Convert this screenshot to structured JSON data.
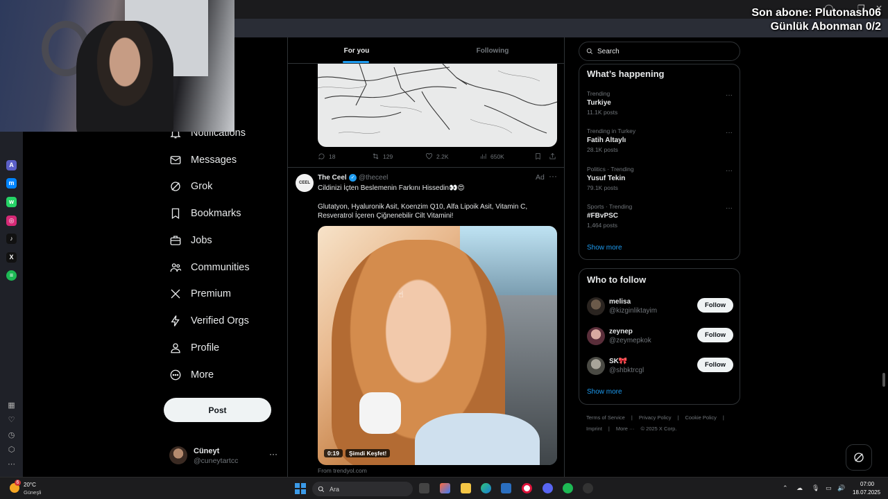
{
  "overlay": {
    "last_subscriber": "Son abone: Plutonash06",
    "daily_subscribers": "Günlük Abonman 0/2"
  },
  "nav": {
    "items": [
      {
        "label": "Notifications",
        "icon": "bell-icon"
      },
      {
        "label": "Messages",
        "icon": "envelope-icon"
      },
      {
        "label": "Grok",
        "icon": "grok-icon"
      },
      {
        "label": "Bookmarks",
        "icon": "bookmark-icon"
      },
      {
        "label": "Jobs",
        "icon": "briefcase-icon"
      },
      {
        "label": "Communities",
        "icon": "people-icon"
      },
      {
        "label": "Premium",
        "icon": "x-logo-icon"
      },
      {
        "label": "Verified Orgs",
        "icon": "lightning-icon"
      },
      {
        "label": "Profile",
        "icon": "person-icon"
      },
      {
        "label": "More",
        "icon": "more-circle-icon"
      }
    ],
    "post_label": "Post",
    "account": {
      "name": "Cüneyt",
      "handle": "@cuneytartcc",
      "more": "···"
    }
  },
  "feed": {
    "tabs": {
      "for_you": "For you",
      "following": "Following"
    },
    "prev_tweet_actions": {
      "replies": "18",
      "reposts": "129",
      "likes": "2.2K",
      "views": "650K"
    },
    "ad_tweet": {
      "avatar_text": "CEEL",
      "name": "The Ceel",
      "handle": "@theceel",
      "ad_label": "Ad",
      "more": "···",
      "line1": "Cildinizi İçten Beslemenin Farkını Hissedin👀😍",
      "line2": "Glutatyon, Hyaluronik Asit, Koenzim Q10, Alfa Lipoik Asit, Vitamin C, Resveratrol İçeren Çiğnenebilir Cilt Vitamini!",
      "video_time": "0:19",
      "video_cta": "Şimdi Keşfet!",
      "source": "From trendyol.com"
    }
  },
  "sidebar": {
    "search_placeholder": "Search",
    "whats_happening": {
      "title": "What’s happening",
      "trends": [
        {
          "category": "Trending",
          "name": "Turkiye",
          "posts": "11.1K posts"
        },
        {
          "category": "Trending in Turkey",
          "name": "Fatih Altaylı",
          "posts": "28.1K posts"
        },
        {
          "category": "Politics · Trending",
          "name": "Yusuf Tekin",
          "posts": "79.1K posts"
        },
        {
          "category": "Sports · Trending",
          "name": "#FBvPSC",
          "posts": "1,464 posts"
        }
      ],
      "show_more": "Show more"
    },
    "who_to_follow": {
      "title": "Who to follow",
      "users": [
        {
          "name": "melisa",
          "handle": "@kizginliktayim",
          "follow": "Follow"
        },
        {
          "name": "zeynep",
          "handle": "@zeymepkok",
          "follow": "Follow"
        },
        {
          "name": "SK🎀",
          "handle": "@shbktrcgl",
          "follow": "Follow"
        }
      ],
      "show_more": "Show more"
    },
    "footer": {
      "row1": [
        "Terms of Service",
        "|",
        "Privacy Policy",
        "|",
        "Cookie Policy",
        "|"
      ],
      "row2": [
        "Imprint",
        "|",
        "More ···",
        "© 2025 X Corp."
      ]
    }
  },
  "taskbar": {
    "weather_badge": "6",
    "weather_temp": "20°C",
    "weather_desc": "Güneşli",
    "search_placeholder": "Ara",
    "time": "07:00",
    "date": "18.07.2025"
  },
  "colors": {
    "accent": "#1d9bf0",
    "background": "#000000",
    "border": "#2f3336",
    "muted": "#71767b"
  }
}
